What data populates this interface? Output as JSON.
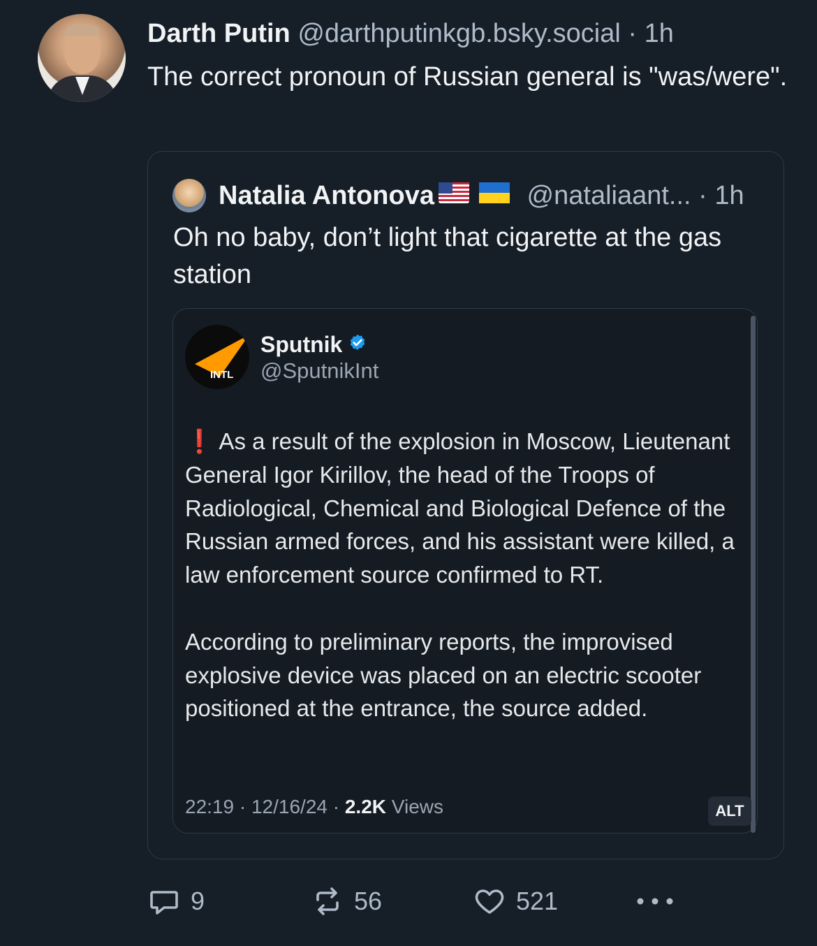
{
  "post": {
    "author_name": "Darth Putin",
    "author_handle": "@darthputinkgb.bsky.social",
    "separator": "·",
    "time": "1h",
    "text": "The correct pronoun of Russian general is \"was/​were\"."
  },
  "quote": {
    "author_name": "Natalia Antonova",
    "flags": [
      "us-flag-icon",
      "ukraine-flag-icon"
    ],
    "author_handle": "@nataliaant...",
    "separator": "·",
    "time": "1h",
    "text": "Oh no baby, don’t light that cigarette at the gas station"
  },
  "embed": {
    "account_name": "Sputnik",
    "account_handle": "@SputnikInt",
    "logo_label": "INTL",
    "verified": "verified-badge-icon",
    "paragraph_1": "❗ As a result of the explosion in Moscow, Lieutenant General Igor Kirillov, the head of the Troops of Radiological, Chemical and Biological Defence of the Russian armed forces, and his assistant were killed, a law enforcement source confirmed to RT.",
    "paragraph_2": "According to preliminary reports, the improvised explosive device was placed on an electric scooter positioned at the entrance, the source added.",
    "time": "22:19",
    "date": "12/16/24",
    "dot": "·",
    "views_count": "2.2K",
    "views_label": "Views",
    "alt_label": "ALT"
  },
  "actions": {
    "replies": "9",
    "reposts": "56",
    "likes": "521"
  },
  "colors": {
    "background": "#161e27",
    "text": "#f1f3f5",
    "muted": "#aebbc9",
    "border": "#2e3a48",
    "verified": "#1d9bf0",
    "sputnik_orange": "#ff9a00"
  }
}
